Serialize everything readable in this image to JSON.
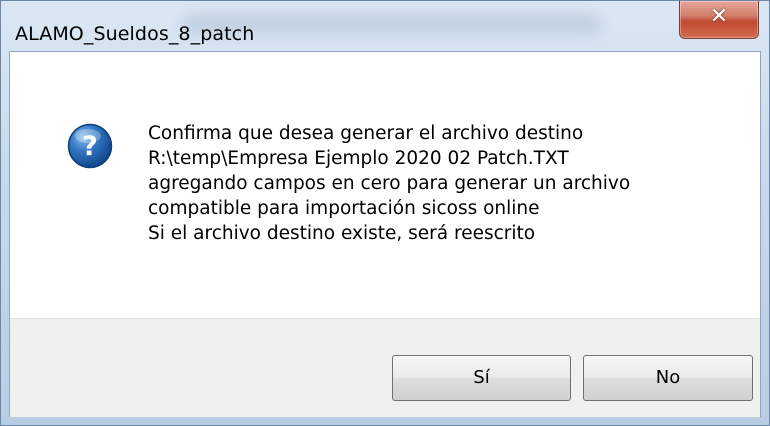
{
  "window": {
    "title": "ALAMO_Sueldos_8_patch"
  },
  "dialog": {
    "icon": "question-icon",
    "message_lines": [
      "Confirma que desea generar el archivo destino",
      "R:\\temp\\Empresa Ejemplo 2020 02 Patch.TXT",
      "agregando campos en cero para generar un archivo",
      "compatible para importación sicoss online",
      "Si el archivo destino existe, será reescrito"
    ]
  },
  "buttons": {
    "yes_label": "Sí",
    "no_label": "No"
  },
  "colors": {
    "close_button": "#c14a32",
    "question_icon": "#1c5fa8",
    "button_area": "#f0f0f0"
  }
}
